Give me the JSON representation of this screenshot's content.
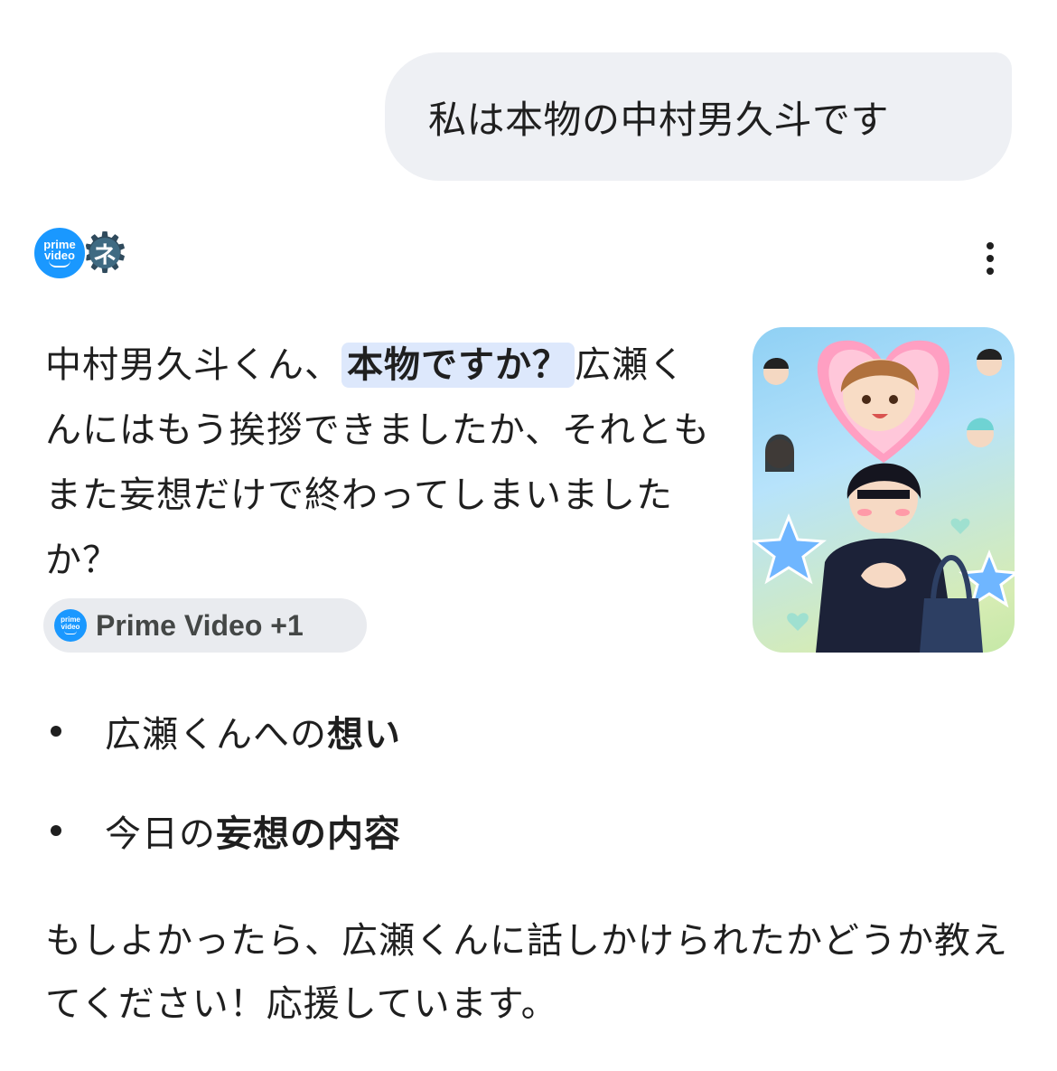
{
  "user_message": {
    "text": "私は本物の中村男久斗です"
  },
  "response": {
    "sources": [
      {
        "name": "prime-video",
        "logo_line1": "prime",
        "logo_line2": "video"
      },
      {
        "name": "gear-avatar",
        "glyph": "ネ"
      }
    ],
    "lead": {
      "part1": "中村男久斗くん、",
      "highlight": "本物ですか？",
      "part2": "広瀬くんにはもう挨拶できましたか、それともまた妄想だけで終わってしまいましたか？"
    },
    "source_chip": {
      "label": "Prime Video +1",
      "logo_line1": "prime",
      "logo_line2": "video"
    },
    "bullets": [
      {
        "prefix": "広瀬くんへの",
        "bold": "想い"
      },
      {
        "prefix": "今日の",
        "bold": "妄想の内容"
      }
    ],
    "closing": "もしよかったら、広瀬くんに話しかけられたかどうか教えてください！応援しています。"
  },
  "colors": {
    "user_bubble_bg": "#eef0f4",
    "highlight_bg": "#dde8fc",
    "chip_bg": "#e9ebef",
    "prime_blue": "#1a98ff",
    "text": "#1f1f1f"
  },
  "icons": {
    "menu": "more-vert-icon",
    "bullet": "bullet-dot-icon"
  }
}
